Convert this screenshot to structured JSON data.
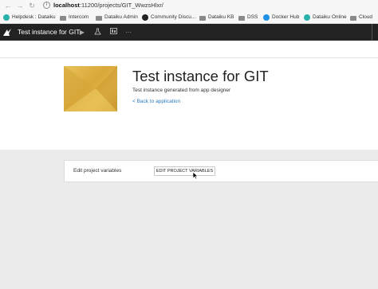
{
  "browser": {
    "url_host": "localhost",
    "url_path": ":11200/projects/GIT_WwzsHlxr/"
  },
  "bookmarks": [
    {
      "label": "Helpdesk : Dataiku",
      "icon": "dataiku-bird-icon",
      "color": "#2ab1ac"
    },
    {
      "label": "Intercom",
      "icon": "folder-icon",
      "color": "#8a8a8a"
    },
    {
      "label": "Dataiku Admin",
      "icon": "folder-icon",
      "color": "#8a8a8a"
    },
    {
      "label": "Community Discu...",
      "icon": "community-icon",
      "color": "#222222"
    },
    {
      "label": "Dataiku KB",
      "icon": "folder-icon",
      "color": "#8a8a8a"
    },
    {
      "label": "DSS",
      "icon": "folder-icon",
      "color": "#8a8a8a"
    },
    {
      "label": "Docker Hub",
      "icon": "docker-icon",
      "color": "#1d91e6"
    },
    {
      "label": "Dataiku Online",
      "icon": "dataiku-bird-icon",
      "color": "#2ab1ac"
    },
    {
      "label": "Cloud",
      "icon": "folder-icon",
      "color": "#8a8a8a"
    }
  ],
  "header": {
    "project_name": "Test instance for GIT"
  },
  "main": {
    "title": "Test instance for GIT",
    "subtitle": "Test instance generated from app designer",
    "back_link": "< Back to application"
  },
  "variables_card": {
    "label": "Edit project variables",
    "button_label": "EDIT PROJECT VARIABLES"
  },
  "colors": {
    "header_bg": "#222222",
    "link": "#2d7cbf",
    "thumbnail": "#e0b54a"
  }
}
